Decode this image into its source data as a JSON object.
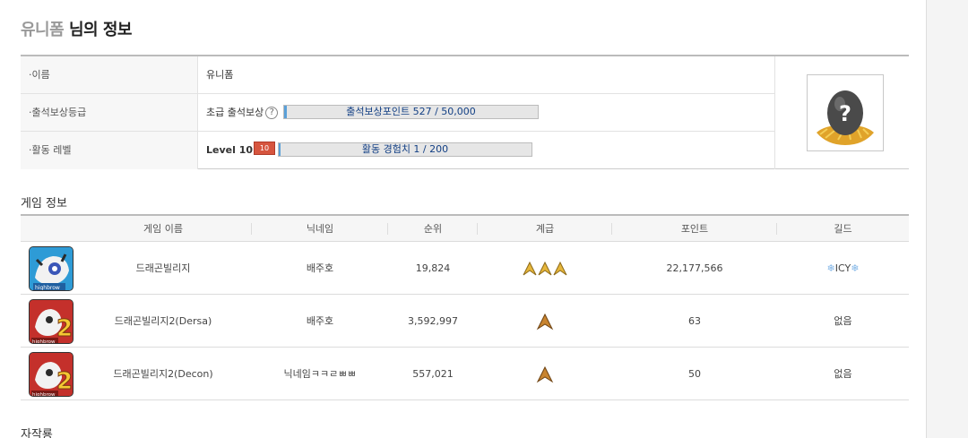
{
  "title": {
    "nickname": "유니폼",
    "suffix": "님의 정보"
  },
  "profile": {
    "name_label": "·이름",
    "name_value": "유니폼",
    "attend_label": "·출석보상등급",
    "attend_grade": "초급 출석보상",
    "attend_help": "?",
    "attend_bar_text": "출석보상포인트 527 / 50,000",
    "attend_progress": 0.0105,
    "level_label": "·활동 레벨",
    "level_value": "Level 10",
    "level_badge": "10",
    "exp_bar_text": "활동 경험치 1 / 200",
    "exp_progress": 0.005,
    "avatar_icon": "egg-question-avatar"
  },
  "game_section_title": "게임 정보",
  "game_table": {
    "headers": [
      "게임 이름",
      "닉네임",
      "순위",
      "계급",
      "포인트",
      "길드"
    ],
    "rows": [
      {
        "icon": "dragon-village-icon",
        "game": "드래곤빌리지",
        "nick": "배주호",
        "rank": "19,824",
        "grade_chevrons": 3,
        "grade_color": "#e2b437",
        "points": "22,177,566",
        "guild": "ICY",
        "guild_icon": "snowflake-icon"
      },
      {
        "icon": "dragon-village-2-icon",
        "game": "드래곤빌리지2(Dersa)",
        "nick": "배주호",
        "rank": "3,592,997",
        "grade_chevrons": 1,
        "grade_color": "#c8822f",
        "points": "63",
        "guild": "없음"
      },
      {
        "icon": "dragon-village-2-icon",
        "game": "드래곤빌리지2(Decon)",
        "nick": "닉네임ㅋㅋㄹㅃㅃ",
        "rank": "557,021",
        "grade_chevrons": 1,
        "grade_color": "#c8822f",
        "points": "50",
        "guild": "없음"
      }
    ]
  },
  "next_section_title": "자작룡"
}
